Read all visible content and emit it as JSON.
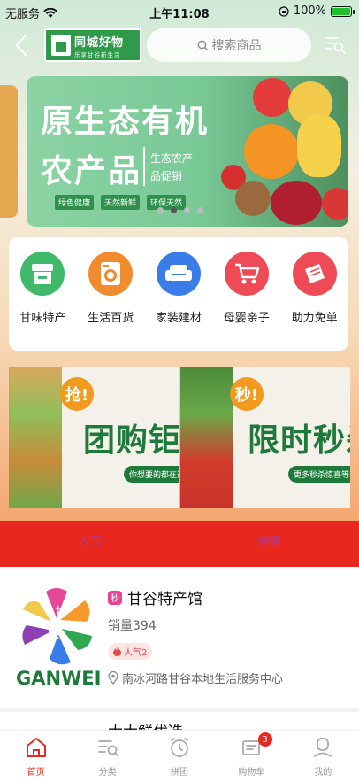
{
  "status_bar": {
    "carrier": "无服务",
    "time": "上午11:08",
    "battery": "100%"
  },
  "header": {
    "logo_title": "同城好物",
    "logo_subtitle": "乐享甘谷新生活",
    "search_placeholder": "搜索商品"
  },
  "banner": {
    "line1": "原生态有机",
    "line2": "农产品",
    "side1": "生态农产",
    "side2": "品促销",
    "tags": [
      "绿色健康",
      "天然新鲜",
      "环保天然"
    ],
    "active_index": 1,
    "slide_count": 4
  },
  "categories": [
    {
      "label": "甘味特产",
      "icon": "store-icon",
      "color": "#3fb96a"
    },
    {
      "label": "生活百货",
      "icon": "washer-icon",
      "color": "#f28a2e"
    },
    {
      "label": "家装建材",
      "icon": "sofa-icon",
      "color": "#3a7de8"
    },
    {
      "label": "母婴亲子",
      "icon": "cart-icon",
      "color": "#ee4b57"
    },
    {
      "label": "助力免单",
      "icon": "ticket-icon",
      "color": "#ee4b57"
    }
  ],
  "promos": [
    {
      "badge": "抢!",
      "title": "团购钜惠",
      "sub": "你想要的都在这"
    },
    {
      "badge": "秒!",
      "title": "限时秒杀",
      "sub": "更多秒杀惊喜等着你"
    }
  ],
  "tabs": [
    "人气",
    "销量"
  ],
  "shop": {
    "badge": "秒",
    "name": "甘谷特产馆",
    "sales": "销量394",
    "popularity": "人气2",
    "address": "南冰河路甘谷本地生活服务中心",
    "brand": "GANWEI",
    "logo_chars": [
      "甘",
      "味"
    ]
  },
  "next_shop": {
    "name": "大大鲜优选"
  },
  "bottom_nav": [
    {
      "label": "首页",
      "icon": "home-icon",
      "active": true
    },
    {
      "label": "分类",
      "icon": "category-icon",
      "active": false
    },
    {
      "label": "拼团",
      "icon": "clock-icon",
      "active": false
    },
    {
      "label": "购物车",
      "icon": "cart-icon",
      "active": false,
      "badge": "3"
    },
    {
      "label": "我的",
      "icon": "profile-icon",
      "active": false
    }
  ],
  "colors": {
    "accent": "#e8271e",
    "green": "#2f9b4a"
  }
}
